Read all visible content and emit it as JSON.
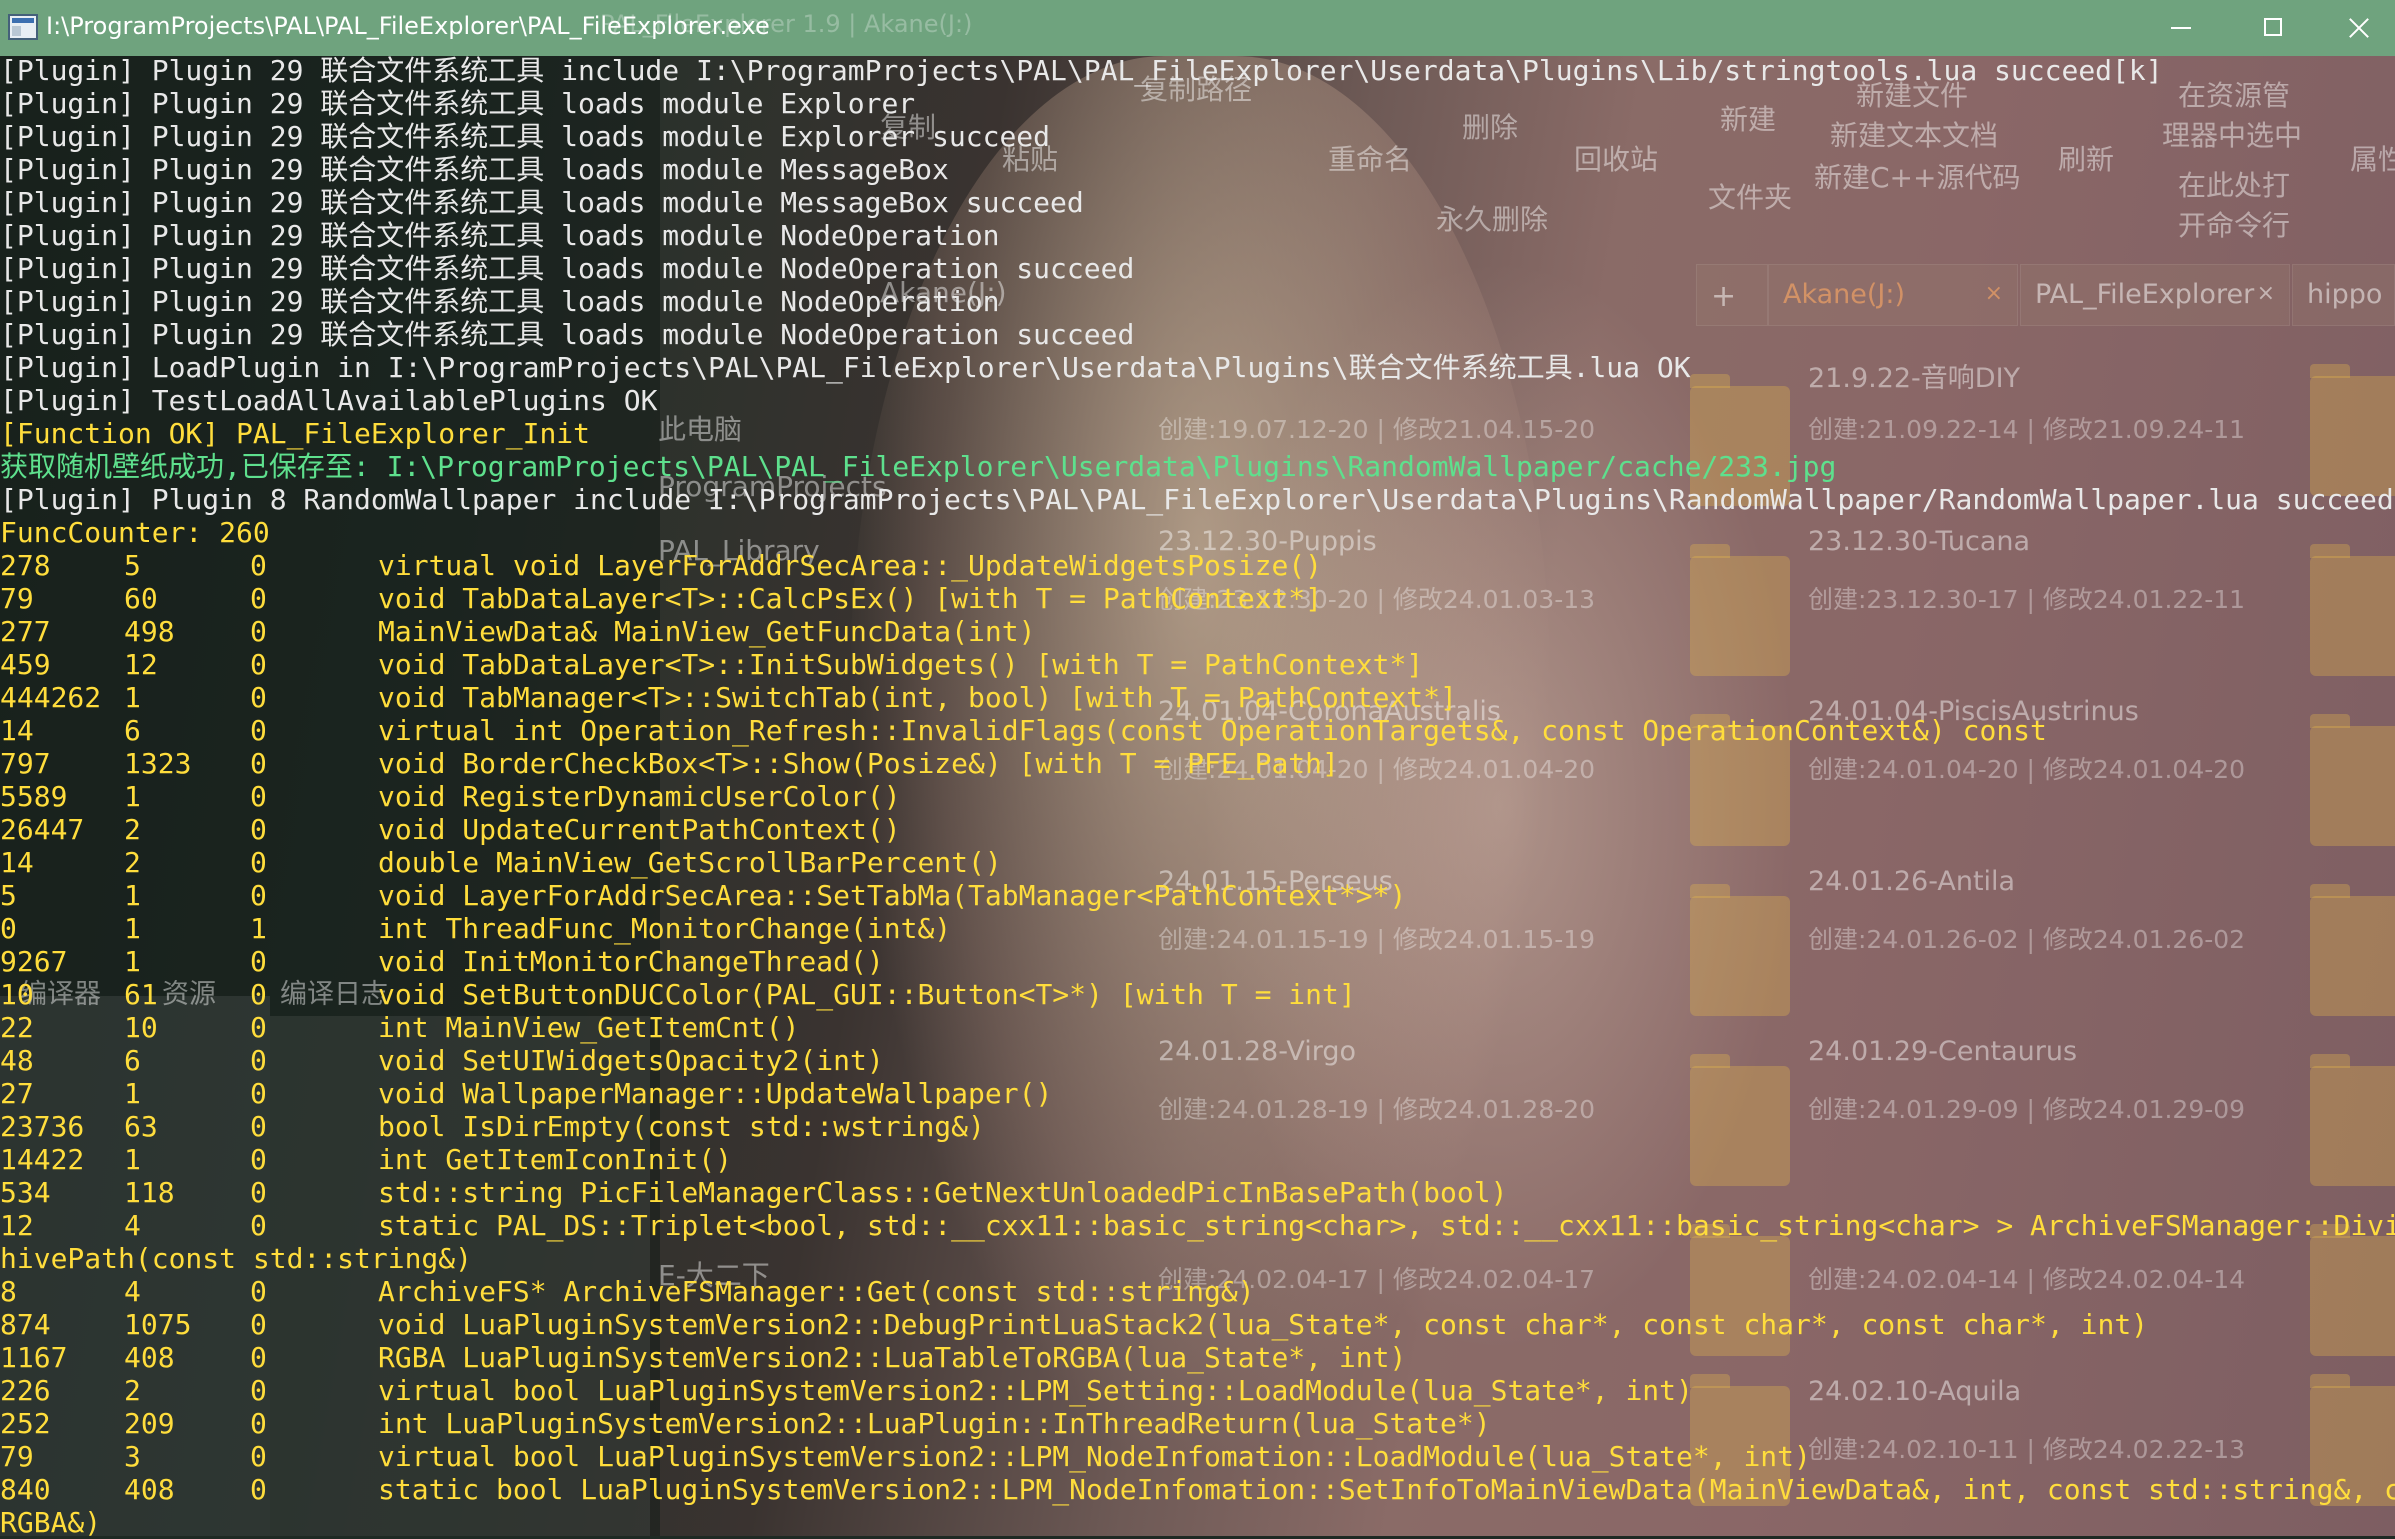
{
  "window": {
    "title": "I:\\ProgramProjects\\PAL\\PAL_FileExplorer\\PAL_FileExplorer.exe",
    "ghost_title": "PAL_FileExplorer 1.9 | Akane(J:)"
  },
  "background_explorer": {
    "toolbar": [
      "复制路径",
      "删除",
      "新建",
      "新建文件",
      "在资源管",
      "理器中选中",
      "复制",
      "粘贴",
      "重命名",
      "回收站",
      "新建文本文档",
      "刷新",
      "属性",
      "新建C++源代码",
      "文件夹",
      "在此处打",
      "开命令行",
      "永久删除"
    ],
    "tabs": [
      {
        "label": "Akane(J:)"
      },
      {
        "label": "PAL_FileExplorer"
      },
      {
        "label": "hippo"
      }
    ],
    "tree": [
      "此电脑",
      "ProgramProjects",
      "PAL_Library",
      "E-大二下",
      "Akane(J:)"
    ],
    "items": [
      {
        "name": "",
        "meta": "创建:19.07.12-20 | 修改21.04.15-20"
      },
      {
        "name": "21.9.22-音响DIY",
        "meta": "创建:21.09.22-14 | 修改21.09.24-11"
      },
      {
        "name": "23.12.30-Puppis",
        "meta": "创建:23.12.30-20 | 修改24.01.03-13"
      },
      {
        "name": "23.12.30-Tucana",
        "meta": "创建:23.12.30-17 | 修改24.01.22-11"
      },
      {
        "name": "24.01.04-CoronaAustralis",
        "meta": "创建:24.01.04-20 | 修改24.01.04-20"
      },
      {
        "name": "24.01.04-PiscisAustrinus",
        "meta": "创建:24.01.04-20 | 修改24.01.04-20"
      },
      {
        "name": "24.01.15-Perseus",
        "meta": "创建:24.01.15-19 | 修改24.01.15-19"
      },
      {
        "name": "24.01.26-Antila",
        "meta": "创建:24.01.26-02 | 修改24.01.26-02"
      },
      {
        "name": "24.01.28-Virgo",
        "meta": "创建:24.01.28-19 | 修改24.01.28-20"
      },
      {
        "name": "24.01.29-Centaurus",
        "meta": "创建:24.01.29-09 | 修改24.01.29-09"
      },
      {
        "name": "",
        "meta": "创建:24.02.04-17 | 修改24.02.04-17"
      },
      {
        "name": "",
        "meta": "创建:24.02.04-14 | 修改24.02.04-14"
      },
      {
        "name": "24.02.10-Aquila",
        "meta": "创建:24.02.10-11 | 修改24.02.22-13"
      }
    ],
    "ide_tabs": [
      "编译器",
      "资源",
      "编译日志"
    ]
  },
  "console": {
    "log_lines": [
      {
        "text": "[Plugin] Plugin 29 联合文件系统工具 include I:\\ProgramProjects\\PAL\\PAL_FileExplorer\\Userdata\\Plugins\\Lib/stringtools.lua succeed[k]",
        "color": "#e8e8e8"
      },
      {
        "text": "[Plugin] Plugin 29 联合文件系统工具 loads module Explorer",
        "color": "#e8e8e8"
      },
      {
        "text": "[Plugin] Plugin 29 联合文件系统工具 loads module Explorer succeed",
        "color": "#e8e8e8"
      },
      {
        "text": "[Plugin] Plugin 29 联合文件系统工具 loads module MessageBox",
        "color": "#e8e8e8"
      },
      {
        "text": "[Plugin] Plugin 29 联合文件系统工具 loads module MessageBox succeed",
        "color": "#e8e8e8"
      },
      {
        "text": "[Plugin] Plugin 29 联合文件系统工具 loads module NodeOperation",
        "color": "#e8e8e8"
      },
      {
        "text": "[Plugin] Plugin 29 联合文件系统工具 loads module NodeOperation succeed",
        "color": "#e8e8e8"
      },
      {
        "text": "[Plugin] Plugin 29 联合文件系统工具 loads module NodeOperation",
        "color": "#e8e8e8"
      },
      {
        "text": "[Plugin] Plugin 29 联合文件系统工具 loads module NodeOperation succeed",
        "color": "#e8e8e8"
      },
      {
        "text": "[Plugin] LoadPlugin in I:\\ProgramProjects\\PAL\\PAL_FileExplorer\\Userdata\\Plugins\\联合文件系统工具.lua OK",
        "color": "#e8e8e8"
      },
      {
        "text": "[Plugin] TestLoadAllAvailablePlugins OK",
        "color": "#e8e8e8"
      },
      {
        "text": "[Function OK] PAL_FileExplorer_Init",
        "color": "#ffdd3c"
      },
      {
        "text": "获取随机壁纸成功,已保存至: I:\\ProgramProjects\\PAL\\PAL_FileExplorer\\Userdata\\Plugins\\RandomWallpaper/cache/233.jpg",
        "color": "#5ee08d"
      },
      {
        "text": "[Plugin] Plugin 8 RandomWallpaper include I:\\ProgramProjects\\PAL\\PAL_FileExplorer\\Userdata\\Plugins\\RandomWallpaper/RandomWallpaper.lua succeed[k]",
        "color": "#e8e8e8"
      },
      {
        "text": "FuncCounter: 260",
        "color": "#ffdd3c"
      }
    ],
    "func_rows": [
      {
        "id": "278",
        "a": "5",
        "b": "0",
        "sig": "virtual void LayerForAddrSecArea::_UpdateWidgetsPosize()"
      },
      {
        "id": "79",
        "a": "60",
        "b": "0",
        "sig": "void TabDataLayer<T>::CalcPsEx() [with T = PathContext*]"
      },
      {
        "id": "277",
        "a": "498",
        "b": "0",
        "sig": "MainViewData& MainView_GetFuncData(int)"
      },
      {
        "id": "459",
        "a": "12",
        "b": "0",
        "sig": "void TabDataLayer<T>::InitSubWidgets() [with T = PathContext*]"
      },
      {
        "id": "444262",
        "a": "1",
        "b": "0",
        "sig": "void TabManager<T>::SwitchTab(int, bool) [with T = PathContext*]"
      },
      {
        "id": "14",
        "a": "6",
        "b": "0",
        "sig": "virtual int Operation_Refresh::InvalidFlags(const OperationTargets&, const OperationContext&) const"
      },
      {
        "id": "797",
        "a": "1323",
        "b": "0",
        "sig": "void BorderCheckBox<T>::Show(Posize&) [with T = PFE_Path]"
      },
      {
        "id": "5589",
        "a": "1",
        "b": "0",
        "sig": "void RegisterDynamicUserColor()"
      },
      {
        "id": "26447",
        "a": "2",
        "b": "0",
        "sig": "void UpdateCurrentPathContext()"
      },
      {
        "id": "14",
        "a": "2",
        "b": "0",
        "sig": "double MainView_GetScrollBarPercent()"
      },
      {
        "id": "5",
        "a": "1",
        "b": "0",
        "sig": "void LayerForAddrSecArea::SetTabMa(TabManager<PathContext*>*)"
      },
      {
        "id": "0",
        "a": "1",
        "b": "1",
        "sig": "int ThreadFunc_MonitorChange(int&)"
      },
      {
        "id": "9267",
        "a": "1",
        "b": "0",
        "sig": "void InitMonitorChangeThread()"
      },
      {
        "id": "10",
        "a": "61",
        "b": "0",
        "sig": "void SetButtonDUCColor(PAL_GUI::Button<T>*) [with T = int]"
      },
      {
        "id": "22",
        "a": "10",
        "b": "0",
        "sig": "int MainView_GetItemCnt()"
      },
      {
        "id": "48",
        "a": "6",
        "b": "0",
        "sig": "void SetUIWidgetsOpacity2(int)"
      },
      {
        "id": "27",
        "a": "1",
        "b": "0",
        "sig": "void WallpaperManager::UpdateWallpaper()"
      },
      {
        "id": "23736",
        "a": "63",
        "b": "0",
        "sig": "bool IsDirEmpty(const std::wstring&)"
      },
      {
        "id": "14422",
        "a": "1",
        "b": "0",
        "sig": "int GetItemIconInit()"
      },
      {
        "id": "534",
        "a": "118",
        "b": "0",
        "sig": "std::string PicFileManagerClass::GetNextUnloadedPicInBasePath(bool)"
      },
      {
        "id": "12",
        "a": "4",
        "b": "0",
        "sig": "static PAL_DS::Triplet<bool, std::__cxx11::basic_string<char>, std::__cxx11::basic_string<char> > ArchiveFSManager::DivideArc"
      }
    ],
    "wrap_text_1": "hivePath(const std::string&)",
    "func_rows_2": [
      {
        "id": "8",
        "a": "4",
        "b": "0",
        "sig": "ArchiveFS* ArchiveFSManager::Get(const std::string&)"
      },
      {
        "id": "874",
        "a": "1075",
        "b": "0",
        "sig": "void LuaPluginSystemVersion2::DebugPrintLuaStack2(lua_State*, const char*, const char*, const char*, int)"
      },
      {
        "id": "1167",
        "a": "408",
        "b": "0",
        "sig": "RGBA LuaPluginSystemVersion2::LuaTableToRGBA(lua_State*, int)"
      },
      {
        "id": "226",
        "a": "2",
        "b": "0",
        "sig": "virtual bool LuaPluginSystemVersion2::LPM_Setting::LoadModule(lua_State*, int)"
      },
      {
        "id": "252",
        "a": "209",
        "b": "0",
        "sig": "int LuaPluginSystemVersion2::LuaPlugin::InThreadReturn(lua_State*)"
      },
      {
        "id": "79",
        "a": "3",
        "b": "0",
        "sig": "virtual bool LuaPluginSystemVersion2::LPM_NodeInfomation::LoadModule(lua_State*, int)"
      },
      {
        "id": "840",
        "a": "408",
        "b": "0",
        "sig": "static bool LuaPluginSystemVersion2::LPM_NodeInfomation::SetInfoToMainViewData(MainViewData&, int, const std::string&, const"
      }
    ],
    "wrap_text_2": "RGBA&)"
  },
  "colors": {
    "title_bar": "#6fa37e",
    "console_default": "#e8e8e8",
    "console_function": "#ffdd3c",
    "console_success": "#5ee08d"
  }
}
